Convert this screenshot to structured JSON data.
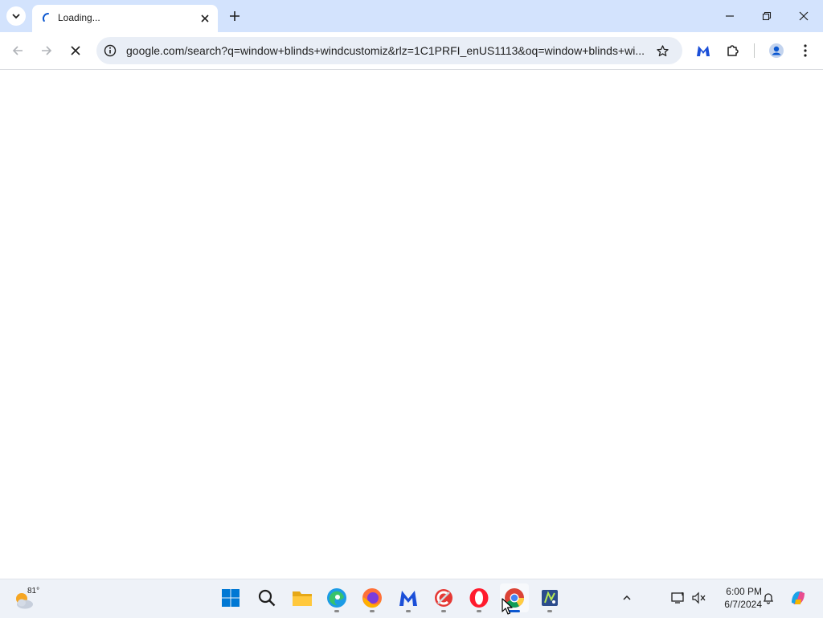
{
  "browser": {
    "tab": {
      "title": "Loading..."
    },
    "address_bar": {
      "url": "google.com/search?q=window+blinds+windcustomiz&rlz=1C1PRFI_enUS1113&oq=window+blinds+wi..."
    },
    "colors": {
      "tabstrip": "#d3e3fd",
      "omnibox": "#e9eef6",
      "accent": "#0b57d0"
    }
  },
  "taskbar": {
    "weather": {
      "temp": "81°"
    },
    "apps": [
      {
        "name": "Start"
      },
      {
        "name": "Search"
      },
      {
        "name": "File Explorer"
      },
      {
        "name": "Microsoft Edge"
      },
      {
        "name": "Firefox"
      },
      {
        "name": "Malwarebytes"
      },
      {
        "name": "CCleaner"
      },
      {
        "name": "Opera"
      },
      {
        "name": "Google Chrome"
      },
      {
        "name": "Notepad++"
      }
    ],
    "clock": {
      "time": "6:00 PM",
      "date": "6/7/2024"
    }
  }
}
